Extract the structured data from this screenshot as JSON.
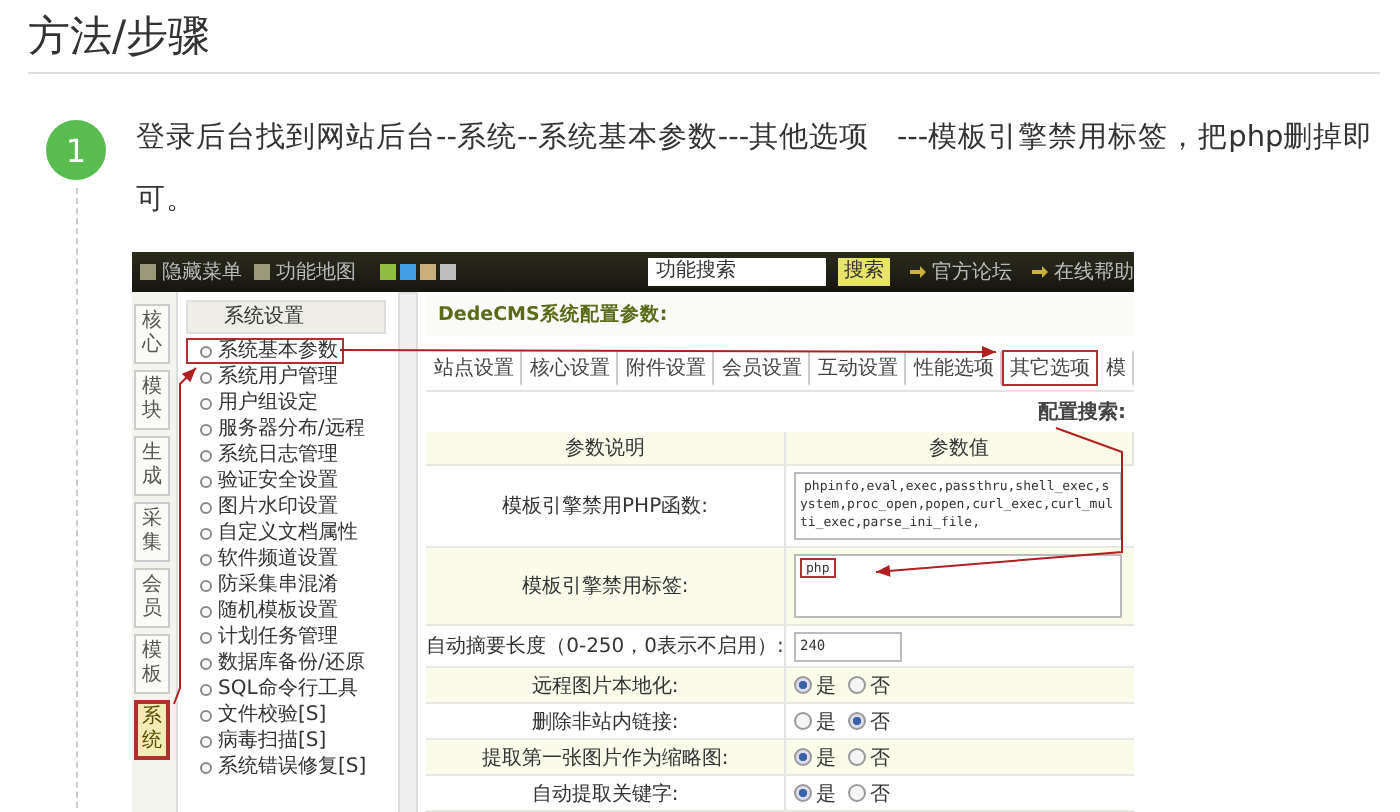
{
  "heading": "方法/步骤",
  "steps": [
    {
      "number": "1",
      "text": "登录后台找到网站后台--系统--系统基本参数---其他选项   ---模板引擎禁用标签，把php删掉即可。",
      "screenshot": {
        "topbar": {
          "links": [
            "隐藏菜单",
            "功能地图"
          ],
          "search": {
            "value": "功能搜索"
          },
          "search_button": "搜索",
          "right_links": [
            "官方论坛",
            "在线帮助"
          ]
        },
        "side_tabs": [
          {
            "label": "核心",
            "selected": false
          },
          {
            "label": "模块",
            "selected": false
          },
          {
            "label": "生成",
            "selected": false
          },
          {
            "label": "采集",
            "selected": false
          },
          {
            "label": "会员",
            "selected": false
          },
          {
            "label": "模板",
            "selected": false
          },
          {
            "label": "系统",
            "selected": true
          }
        ],
        "menu": {
          "title": "系统设置",
          "items": [
            {
              "label": "系统基本参数",
              "selected": true
            },
            {
              "label": "系统用户管理",
              "selected": false
            },
            {
              "label": "用户组设定",
              "selected": false
            },
            {
              "label": "服务器分布/远程",
              "selected": false
            },
            {
              "label": "系统日志管理",
              "selected": false
            },
            {
              "label": "验证安全设置",
              "selected": false
            },
            {
              "label": "图片水印设置",
              "selected": false
            },
            {
              "label": "自定义文档属性",
              "selected": false
            },
            {
              "label": "软件频道设置",
              "selected": false
            },
            {
              "label": "防采集串混淆",
              "selected": false
            },
            {
              "label": "随机模板设置",
              "selected": false
            },
            {
              "label": "计划任务管理",
              "selected": false
            },
            {
              "label": "数据库备份/还原",
              "selected": false
            },
            {
              "label": "SQL命令行工具",
              "selected": false
            },
            {
              "label": "文件校验[S]",
              "selected": false
            },
            {
              "label": "病毒扫描[S]",
              "selected": false
            },
            {
              "label": "系统错误修复[S]",
              "selected": false
            }
          ]
        },
        "main": {
          "title": "DedeCMS系统配置参数:",
          "tabs": [
            {
              "label": "站点设置",
              "selected": false
            },
            {
              "label": "核心设置",
              "selected": false
            },
            {
              "label": "附件设置",
              "selected": false
            },
            {
              "label": "会员设置",
              "selected": false
            },
            {
              "label": "互动设置",
              "selected": false
            },
            {
              "label": "性能选项",
              "selected": false
            },
            {
              "label": "其它选项",
              "selected": true
            },
            {
              "label": "模",
              "selected": false
            }
          ],
          "search_label": "配置搜索:",
          "columns": [
            "参数说明",
            "参数值"
          ],
          "rows": [
            {
              "kind": "textarea",
              "label": "模板引擎禁用PHP函数:",
              "value": "phpinfo,eval,exec,passthru,shell_exec,system,proc_open,popen,curl_exec,curl_multi_exec,parse_ini_file,",
              "highlighted": false
            },
            {
              "kind": "textarea",
              "label": "模板引擎禁用标签:",
              "value": "php",
              "highlighted": true
            },
            {
              "kind": "input",
              "label": "自动摘要长度（0-250，0表示不启用）:",
              "value": "240"
            },
            {
              "kind": "radio",
              "label": "远程图片本地化:",
              "options": [
                {
                  "label": "是",
                  "selected": true
                },
                {
                  "label": "否",
                  "selected": false
                }
              ]
            },
            {
              "kind": "radio",
              "label": "删除非站内链接:",
              "options": [
                {
                  "label": "是",
                  "selected": false
                },
                {
                  "label": "否",
                  "selected": true
                }
              ]
            },
            {
              "kind": "radio",
              "label": "提取第一张图片作为缩略图:",
              "options": [
                {
                  "label": "是",
                  "selected": true
                },
                {
                  "label": "否",
                  "selected": false
                }
              ]
            },
            {
              "kind": "radio",
              "label": "自动提取关键字:",
              "options": [
                {
                  "label": "是",
                  "selected": true
                },
                {
                  "label": "否",
                  "selected": false
                }
              ]
            }
          ]
        }
      }
    }
  ]
}
